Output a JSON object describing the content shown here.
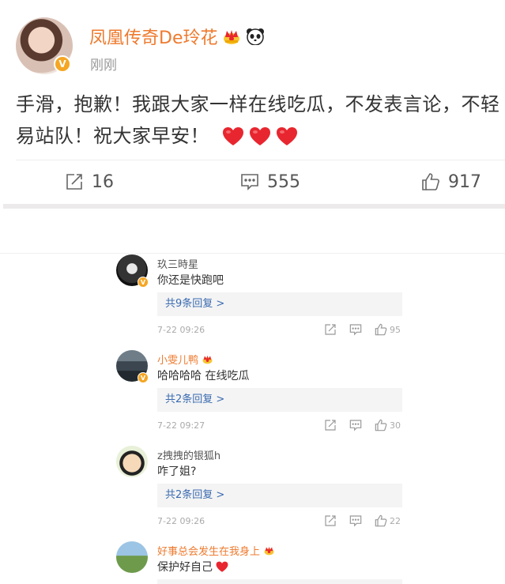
{
  "post": {
    "username": "凤凰传奇De玲花",
    "time": "刚刚",
    "content": "手滑，抱歉！我跟大家一样在线吃瓜，不发表言论，不轻易站队！祝大家早安！",
    "verified_badge": "V",
    "emojis": [
      "crown-icon",
      "panda-icon"
    ],
    "trailing_emojis": [
      "heart-icon",
      "heart-icon",
      "heart-icon"
    ],
    "actions": {
      "repost_count": "16",
      "comment_count": "555",
      "like_count": "917"
    }
  },
  "comments": [
    {
      "name": "玖三時星",
      "text": "你还是快跑吧",
      "replies": "共9条回复 >",
      "time": "7-22 09:26",
      "likes": "95"
    },
    {
      "name": "小雯儿鸭",
      "text": "哈哈哈哈 在线吃瓜",
      "replies": "共2条回复 >",
      "time": "7-22 09:27",
      "likes": "30"
    },
    {
      "name": "z拽拽的银狐h",
      "text": "咋了姐?",
      "replies": "共2条回复 >",
      "time": "7-22 09:26",
      "likes": "22"
    },
    {
      "name": "好事总会发生在我身上",
      "text": "保护好自己"
    }
  ],
  "colors": {
    "accent_orange": "#ee7a2e",
    "link_blue": "#3a6bb1",
    "verified_gold": "#f5a623",
    "heart_red": "#e8262f"
  }
}
